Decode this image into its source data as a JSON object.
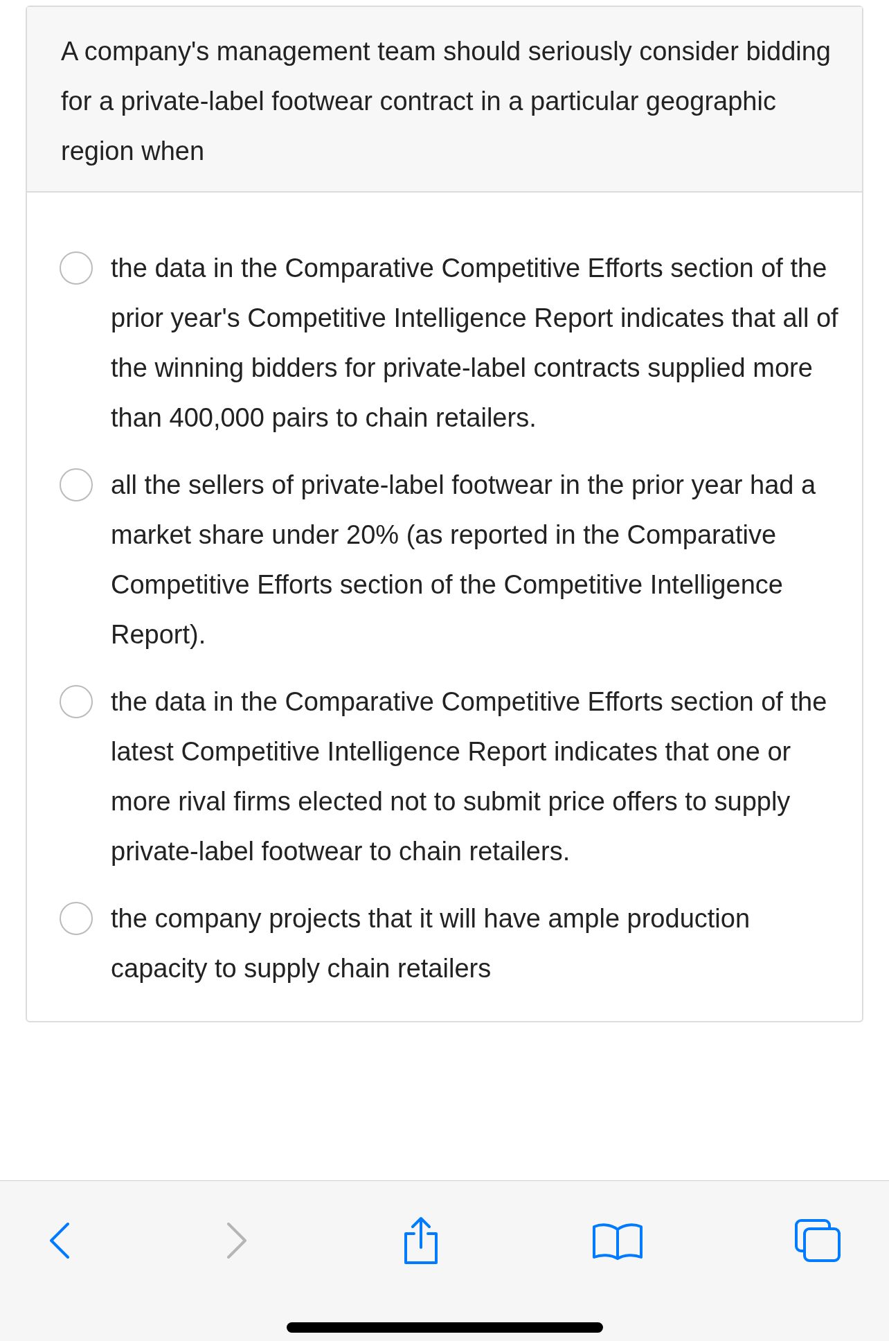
{
  "question": "A company's management team should seriously consider bidding for a private-label footwear contract in a particular geographic region when",
  "options": [
    {
      "text": "the data in the Comparative Competitive Efforts section of the prior year's Competitive Intelligence Report indicates that all of the winning bidders for private-label contracts supplied more than 400,000 pairs to chain retailers.",
      "selected": false
    },
    {
      "text": "all the sellers of private-label footwear in the prior year had a market share under 20% (as reported in the Comparative Competitive Efforts section of the Competitive Intelligence Report).",
      "selected": false
    },
    {
      "text": "the data in the Comparative Competitive Efforts section of the latest Competitive Intelligence Report indicates that one or more rival firms elected not to submit price offers to supply private-label footwear to chain retailers.",
      "selected": false
    },
    {
      "text": "the company projects that it will have ample production capacity to supply chain retailers",
      "selected": false
    }
  ],
  "toolbar": [
    {
      "kind": "back",
      "disabled": false
    },
    {
      "kind": "forward",
      "disabled": true
    },
    {
      "kind": "share",
      "disabled": false
    },
    {
      "kind": "bookmarks",
      "disabled": false
    },
    {
      "kind": "tabs",
      "disabled": false
    }
  ]
}
